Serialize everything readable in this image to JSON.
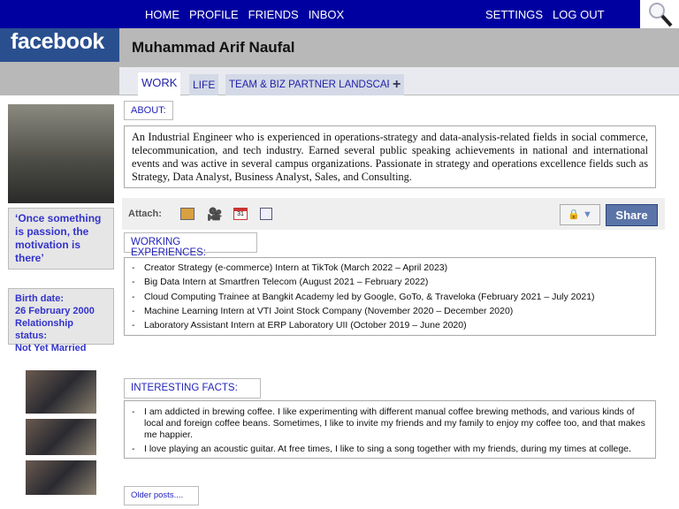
{
  "nav": {
    "left": [
      "HOME",
      "PROFILE",
      "FRIENDS",
      "INBOX"
    ],
    "right": [
      "SETTINGS",
      "LOG OUT"
    ]
  },
  "logo": "facebook",
  "profile_name": "Muhammad Arif Naufal",
  "tabs": [
    "WORK",
    "LIFE",
    "TEAM & BIZ PARTNER LANDSCAPE",
    "+"
  ],
  "quote": "‘Once something is passion, the motivation is there’",
  "info": {
    "birth_label": "Birth date:",
    "birth": "26 February 2000",
    "rel_label": "Relationship status:",
    "rel": "Not Yet Married"
  },
  "about": {
    "label": "ABOUT:",
    "text": "An Industrial Engineer who is experienced in operations-strategy and data-analysis-related fields in social commerce, telecommunication, and tech industry. Earned several public speaking achievements in national and international events and was active in several campus organizations. Passionate in strategy and operations excellence fields such as Strategy, Data Analyst, Business Analyst, Sales, and Consulting."
  },
  "attach": {
    "label": "Attach:",
    "share": "Share"
  },
  "experiences": {
    "label": "WORKING EXPERIENCES:",
    "items": [
      "Creator Strategy (e-commerce) Intern at TikTok (March 2022 – April 2023)",
      "Big Data Intern at Smartfren Telecom (August 2021 – February 2022)",
      "Cloud Computing Trainee at Bangkit Academy led by Google, GoTo, & Traveloka (February 2021 – July 2021)",
      "Machine Learning Intern at VTI Joint Stock Company (November 2020 – December 2020)",
      "Laboratory Assistant Intern at ERP Laboratory UII (October 2019 – June 2020)"
    ]
  },
  "facts": {
    "label": "INTERESTING FACTS:",
    "items": [
      "I am addicted in brewing coffee. I like experimenting with different manual coffee brewing methods, and various kinds of local and foreign coffee beans. Sometimes, I like to invite my friends and my family to enjoy my coffee too, and that makes me happier.",
      "I love playing an acoustic guitar. At free times, I like to sing a song together with my friends, during my times at college."
    ]
  },
  "older": "Older posts...."
}
